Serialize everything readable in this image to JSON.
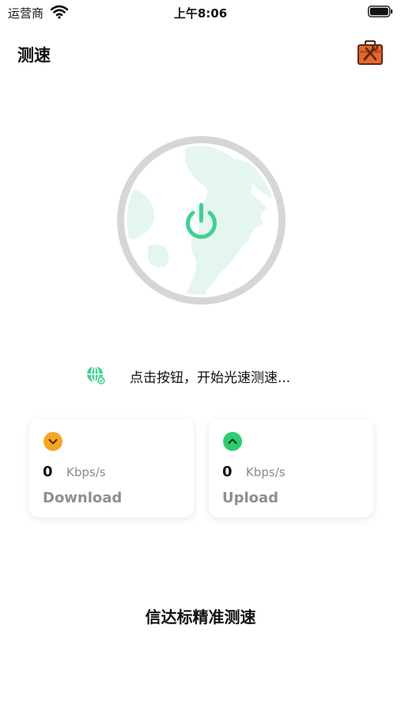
{
  "status_bar": {
    "carrier": "运营商",
    "time": "上午8:06"
  },
  "nav": {
    "title": "测速"
  },
  "hint": {
    "text": "点击按钮，开始光速测速..."
  },
  "download": {
    "value": "0",
    "unit": "Kbps/s",
    "label": "Download",
    "icon": "chevron-down-icon",
    "color": "#F5A623"
  },
  "upload": {
    "value": "0",
    "unit": "Kbps/s",
    "label": "Upload",
    "icon": "chevron-up-icon",
    "color": "#2ECC71"
  },
  "footer": {
    "title": "信达标精准测速"
  },
  "colors": {
    "accent_green": "#3FD193",
    "ring_gray": "#D6D6D6",
    "globe_fill": "#E4F6EE"
  }
}
